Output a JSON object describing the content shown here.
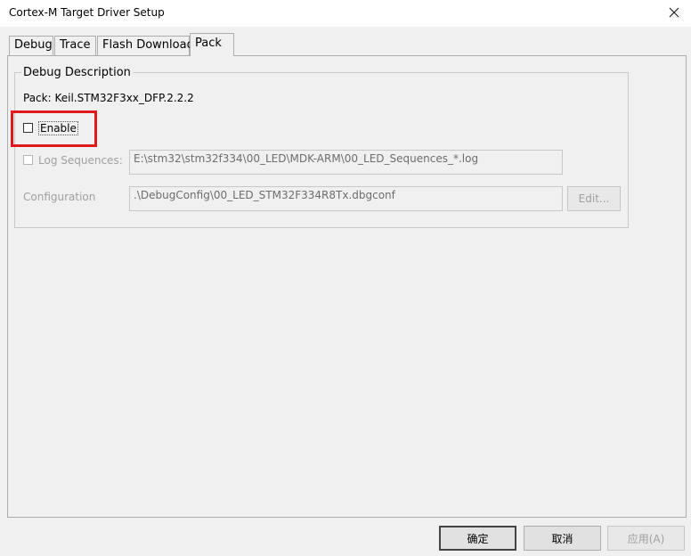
{
  "window": {
    "title": "Cortex-M Target Driver Setup",
    "close_icon": "close-icon"
  },
  "tabs": [
    {
      "label": "Debug"
    },
    {
      "label": "Trace"
    },
    {
      "label": "Flash Download"
    },
    {
      "label": "Pack"
    }
  ],
  "active_tab": "Pack",
  "debug_description": {
    "legend": "Debug Description",
    "pack_label": "Pack:  Keil.STM32F3xx_DFP.2.2.2",
    "enable": {
      "label": "Enable",
      "checked": false
    },
    "log_sequences": {
      "label": "Log Sequences:",
      "checked": false,
      "value": "E:\\stm32\\stm32f334\\00_LED\\MDK-ARM\\00_LED_Sequences_*.log"
    },
    "configuration": {
      "label": "Configuration",
      "value": ".\\DebugConfig\\00_LED_STM32F334R8Tx.dbgconf",
      "edit_button": "Edit..."
    }
  },
  "footer": {
    "ok_button": "确定",
    "cancel_button": "取消",
    "apply_button": "应用(A)"
  },
  "colors": {
    "highlight": "#e0191b",
    "dialog_background": "#f0f0f0",
    "disabled_text": "#a0a0a0"
  }
}
